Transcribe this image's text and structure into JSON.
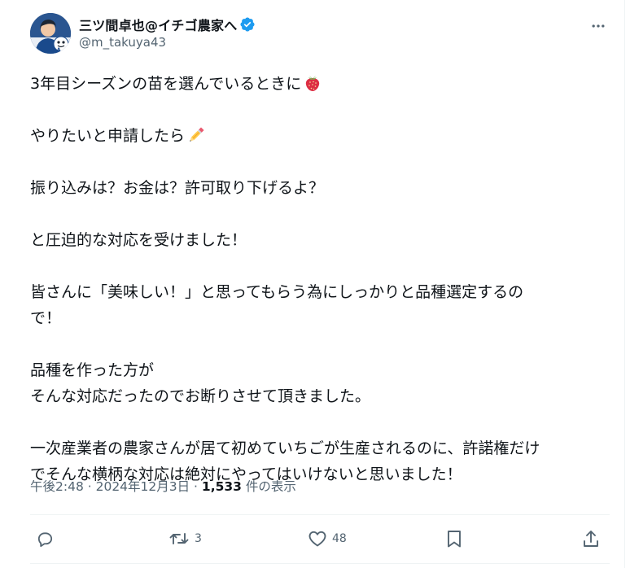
{
  "author": {
    "display_name": "三ツ間卓也@イチゴ農家へ",
    "handle": "@m_takuya43",
    "verified": true
  },
  "more_icon": "ellipsis-icon",
  "body": {
    "paragraphs": [
      {
        "lines": [
          "3年目シーズンの苗を選んでいるときに"
        ],
        "emoji": "strawberry-icon"
      },
      {
        "lines": [
          "やりたいと申請したら"
        ],
        "emoji": "pencil-icon"
      },
      {
        "lines": [
          "振り込みは？お金は？許可取り下げるよ？"
        ]
      },
      {
        "lines": [
          "と圧迫的な対応を受けました！"
        ]
      },
      {
        "lines": [
          "皆さんに「美味しい！」と思ってもらう為にしっかりと品種選定するの",
          "で！"
        ]
      },
      {
        "lines": [
          "品種を作った方が",
          "そんな対応だったのでお断りさせて頂きました。"
        ]
      },
      {
        "lines": [
          "一次産業者の農家さんが居て初めていちごが生産されるのに、許諾権だけ",
          "でそんな横柄な対応は絶対にやってはいけないと思いました！"
        ]
      }
    ]
  },
  "meta": {
    "time": "午後2:48",
    "separator": " · ",
    "date": "2024年12月3日",
    "views_count": "1,533",
    "views_label": " 件の表示"
  },
  "actions": {
    "reply": {
      "icon": "reply-icon",
      "count": ""
    },
    "retweet": {
      "icon": "retweet-icon",
      "count": "3"
    },
    "like": {
      "icon": "heart-icon",
      "count": "48"
    },
    "bookmark": {
      "icon": "bookmark-icon",
      "count": ""
    },
    "share": {
      "icon": "share-icon",
      "count": ""
    }
  },
  "colors": {
    "text": "#0f1419",
    "secondary": "#536471",
    "verified": "#1d9bf0",
    "border": "#eff3f4"
  }
}
